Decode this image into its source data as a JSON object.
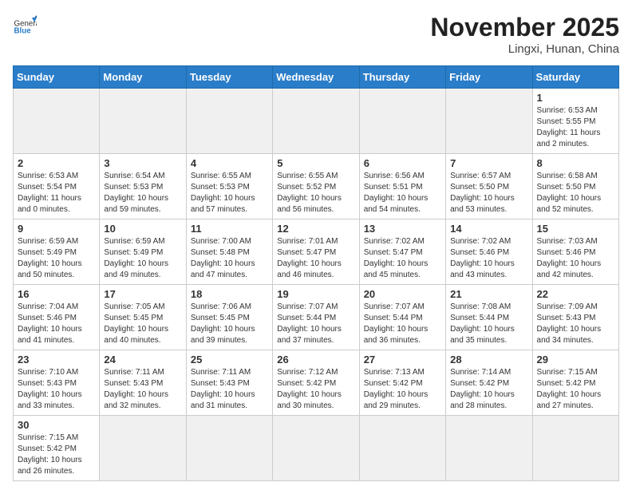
{
  "header": {
    "logo_general": "General",
    "logo_blue": "Blue",
    "month_title": "November 2025",
    "location": "Lingxi, Hunan, China"
  },
  "weekdays": [
    "Sunday",
    "Monday",
    "Tuesday",
    "Wednesday",
    "Thursday",
    "Friday",
    "Saturday"
  ],
  "weeks": [
    [
      {
        "day": "",
        "empty": true
      },
      {
        "day": "",
        "empty": true
      },
      {
        "day": "",
        "empty": true
      },
      {
        "day": "",
        "empty": true
      },
      {
        "day": "",
        "empty": true
      },
      {
        "day": "",
        "empty": true
      },
      {
        "day": "1",
        "sunrise": "6:53 AM",
        "sunset": "5:55 PM",
        "daylight": "11 hours and 2 minutes."
      }
    ],
    [
      {
        "day": "2",
        "sunrise": "6:53 AM",
        "sunset": "5:54 PM",
        "daylight": "11 hours and 0 minutes."
      },
      {
        "day": "3",
        "sunrise": "6:54 AM",
        "sunset": "5:53 PM",
        "daylight": "10 hours and 59 minutes."
      },
      {
        "day": "4",
        "sunrise": "6:55 AM",
        "sunset": "5:53 PM",
        "daylight": "10 hours and 57 minutes."
      },
      {
        "day": "5",
        "sunrise": "6:55 AM",
        "sunset": "5:52 PM",
        "daylight": "10 hours and 56 minutes."
      },
      {
        "day": "6",
        "sunrise": "6:56 AM",
        "sunset": "5:51 PM",
        "daylight": "10 hours and 54 minutes."
      },
      {
        "day": "7",
        "sunrise": "6:57 AM",
        "sunset": "5:50 PM",
        "daylight": "10 hours and 53 minutes."
      },
      {
        "day": "8",
        "sunrise": "6:58 AM",
        "sunset": "5:50 PM",
        "daylight": "10 hours and 52 minutes."
      }
    ],
    [
      {
        "day": "9",
        "sunrise": "6:59 AM",
        "sunset": "5:49 PM",
        "daylight": "10 hours and 50 minutes."
      },
      {
        "day": "10",
        "sunrise": "6:59 AM",
        "sunset": "5:49 PM",
        "daylight": "10 hours and 49 minutes."
      },
      {
        "day": "11",
        "sunrise": "7:00 AM",
        "sunset": "5:48 PM",
        "daylight": "10 hours and 47 minutes."
      },
      {
        "day": "12",
        "sunrise": "7:01 AM",
        "sunset": "5:47 PM",
        "daylight": "10 hours and 46 minutes."
      },
      {
        "day": "13",
        "sunrise": "7:02 AM",
        "sunset": "5:47 PM",
        "daylight": "10 hours and 45 minutes."
      },
      {
        "day": "14",
        "sunrise": "7:02 AM",
        "sunset": "5:46 PM",
        "daylight": "10 hours and 43 minutes."
      },
      {
        "day": "15",
        "sunrise": "7:03 AM",
        "sunset": "5:46 PM",
        "daylight": "10 hours and 42 minutes."
      }
    ],
    [
      {
        "day": "16",
        "sunrise": "7:04 AM",
        "sunset": "5:46 PM",
        "daylight": "10 hours and 41 minutes."
      },
      {
        "day": "17",
        "sunrise": "7:05 AM",
        "sunset": "5:45 PM",
        "daylight": "10 hours and 40 minutes."
      },
      {
        "day": "18",
        "sunrise": "7:06 AM",
        "sunset": "5:45 PM",
        "daylight": "10 hours and 39 minutes."
      },
      {
        "day": "19",
        "sunrise": "7:07 AM",
        "sunset": "5:44 PM",
        "daylight": "10 hours and 37 minutes."
      },
      {
        "day": "20",
        "sunrise": "7:07 AM",
        "sunset": "5:44 PM",
        "daylight": "10 hours and 36 minutes."
      },
      {
        "day": "21",
        "sunrise": "7:08 AM",
        "sunset": "5:44 PM",
        "daylight": "10 hours and 35 minutes."
      },
      {
        "day": "22",
        "sunrise": "7:09 AM",
        "sunset": "5:43 PM",
        "daylight": "10 hours and 34 minutes."
      }
    ],
    [
      {
        "day": "23",
        "sunrise": "7:10 AM",
        "sunset": "5:43 PM",
        "daylight": "10 hours and 33 minutes."
      },
      {
        "day": "24",
        "sunrise": "7:11 AM",
        "sunset": "5:43 PM",
        "daylight": "10 hours and 32 minutes."
      },
      {
        "day": "25",
        "sunrise": "7:11 AM",
        "sunset": "5:43 PM",
        "daylight": "10 hours and 31 minutes."
      },
      {
        "day": "26",
        "sunrise": "7:12 AM",
        "sunset": "5:42 PM",
        "daylight": "10 hours and 30 minutes."
      },
      {
        "day": "27",
        "sunrise": "7:13 AM",
        "sunset": "5:42 PM",
        "daylight": "10 hours and 29 minutes."
      },
      {
        "day": "28",
        "sunrise": "7:14 AM",
        "sunset": "5:42 PM",
        "daylight": "10 hours and 28 minutes."
      },
      {
        "day": "29",
        "sunrise": "7:15 AM",
        "sunset": "5:42 PM",
        "daylight": "10 hours and 27 minutes."
      }
    ],
    [
      {
        "day": "30",
        "sunrise": "7:15 AM",
        "sunset": "5:42 PM",
        "daylight": "10 hours and 26 minutes."
      },
      {
        "day": "",
        "empty": true
      },
      {
        "day": "",
        "empty": true
      },
      {
        "day": "",
        "empty": true
      },
      {
        "day": "",
        "empty": true
      },
      {
        "day": "",
        "empty": true
      },
      {
        "day": "",
        "empty": true
      }
    ]
  ],
  "labels": {
    "sunrise": "Sunrise:",
    "sunset": "Sunset:",
    "daylight": "Daylight:"
  }
}
